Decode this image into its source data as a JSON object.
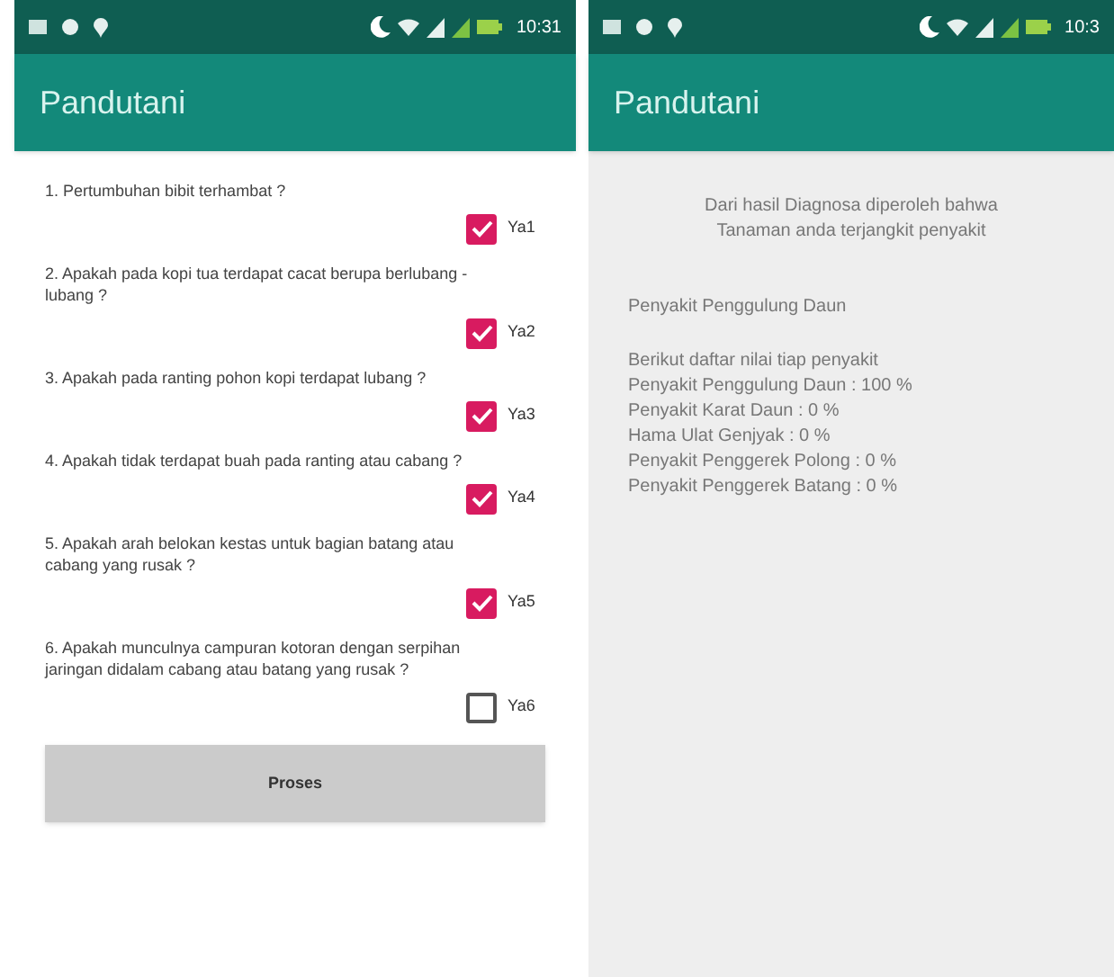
{
  "screens": [
    {
      "status_bar": {
        "time": "10:31"
      },
      "app_bar": {
        "title": "Pandutani"
      },
      "kind": "form",
      "questions": [
        {
          "text": "1. Pertumbuhan bibit terhambat ?",
          "option": "Ya1",
          "checked": true
        },
        {
          "text": "2. Apakah pada kopi tua terdapat cacat berupa berlubang - lubang ?",
          "option": "Ya2",
          "checked": true
        },
        {
          "text": "3. Apakah pada ranting pohon kopi terdapat lubang ?",
          "option": "Ya3",
          "checked": true
        },
        {
          "text": "4. Apakah tidak terdapat buah pada ranting atau cabang ?",
          "option": "Ya4",
          "checked": true
        },
        {
          "text": "5. Apakah arah belokan kestas untuk bagian batang atau cabang yang rusak ?",
          "option": "Ya5",
          "checked": true
        },
        {
          "text": "6. Apakah munculnya campuran kotoran dengan serpihan jaringan didalam cabang atau batang yang rusak ?",
          "option": "Ya6",
          "checked": false
        }
      ],
      "button": "Proses"
    },
    {
      "status_bar": {
        "time": "10:3"
      },
      "app_bar": {
        "title": "Pandutani"
      },
      "kind": "result",
      "intro": [
        "Dari hasil Diagnosa diperoleh bahwa",
        "Tanaman anda terjangkit penyakit"
      ],
      "diagnosis": "Penyakit Penggulung Daun",
      "list_title": "Berikut daftar nilai tiap penyakit",
      "scores": [
        "Penyakit Penggulung Daun : 100 %",
        "Penyakit Karat Daun : 0 %",
        "Hama Ulat Genjyak : 0 %",
        "Penyakit Penggerek Polong : 0 %",
        "Penyakit Penggerek Batang : 0 %"
      ]
    }
  ]
}
